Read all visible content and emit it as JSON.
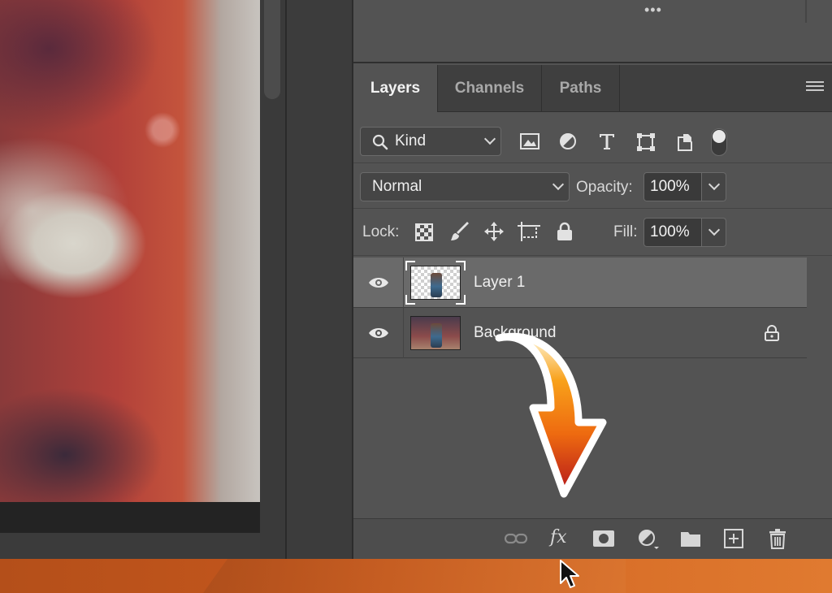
{
  "tabs": [
    {
      "label": "Layers",
      "active": true
    },
    {
      "label": "Channels",
      "active": false
    },
    {
      "label": "Paths",
      "active": false
    }
  ],
  "top_panel": {
    "more_label": "•••"
  },
  "filter": {
    "kind_label": "Kind"
  },
  "blend": {
    "mode": "Normal",
    "opacity_label": "Opacity:",
    "opacity_value": "100%"
  },
  "lock": {
    "label": "Lock:",
    "fill_label": "Fill:",
    "fill_value": "100%"
  },
  "layers": [
    {
      "name": "Layer 1",
      "selected": true,
      "visible": true,
      "transparent": true,
      "locked": false
    },
    {
      "name": "Background",
      "selected": false,
      "visible": true,
      "transparent": false,
      "locked": true
    }
  ],
  "bottom_bar": {
    "fx_label": "fx"
  },
  "colors": {
    "panel": "#535353",
    "tab_bar": "#3f3f3f",
    "selected_layer": "#6a6a6a",
    "arrow_top": "#f8a11a",
    "arrow_bottom": "#b4161b"
  },
  "icons": [
    "search-icon",
    "image-filter-icon",
    "adjustment-filter-icon",
    "type-filter-icon",
    "shape-filter-icon",
    "smart-object-filter-icon",
    "filter-toggle-icon",
    "lock-pixels-icon",
    "lock-paint-icon",
    "lock-position-icon",
    "lock-artboard-icon",
    "lock-all-icon",
    "eye-icon",
    "lock-icon",
    "link-icon",
    "fx-icon",
    "mask-icon",
    "adjustment-layer-icon",
    "folder-icon",
    "new-layer-icon",
    "trash-icon"
  ]
}
